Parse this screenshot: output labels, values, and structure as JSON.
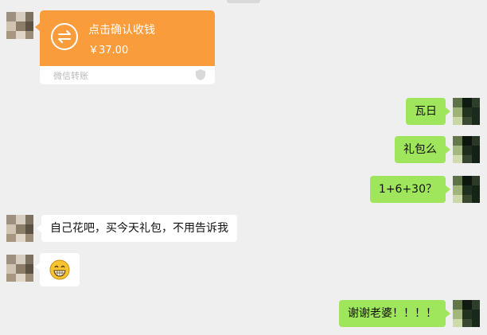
{
  "transfer": {
    "title": "点击确认收钱",
    "amount": "￥37.00",
    "brand": "微信转账",
    "colors": {
      "card": "#f89c3c",
      "footer_text": "#b8b8b8"
    },
    "icon": "transfer-arrows-icon"
  },
  "messages": {
    "m1": "瓦日",
    "m2": "礼包么",
    "m3": "1+6+30？",
    "m4": "自己花吧，买今天礼包，不用告诉我",
    "m6": "谢谢老婆！！！！"
  },
  "emoji": {
    "icon": "grinning-face-icon"
  },
  "colors": {
    "background": "#efefef",
    "outgoing_bubble": "#9fe65c",
    "incoming_bubble": "#ffffff"
  }
}
